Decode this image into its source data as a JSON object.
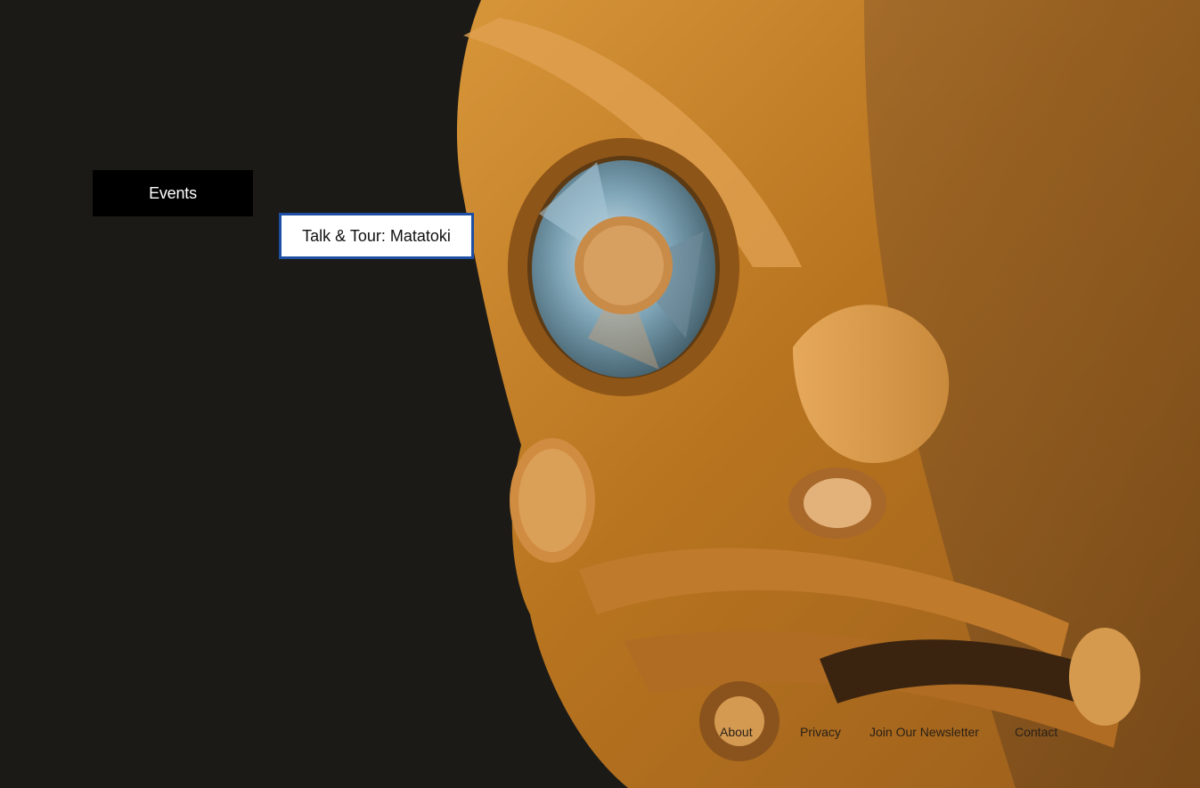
{
  "nav": {
    "events_label": "Events"
  },
  "subnav": {
    "item_label": "Talk & Tour: Matatoki"
  },
  "footer": {
    "about": "About",
    "privacy": "Privacy",
    "join": "Join Our Newsletter",
    "contact": "Contact"
  },
  "colors": {
    "background": "#1b1a16",
    "nav_bg": "#000000",
    "subnav_border": "#1e4fa3",
    "wood": "#c8862c"
  }
}
